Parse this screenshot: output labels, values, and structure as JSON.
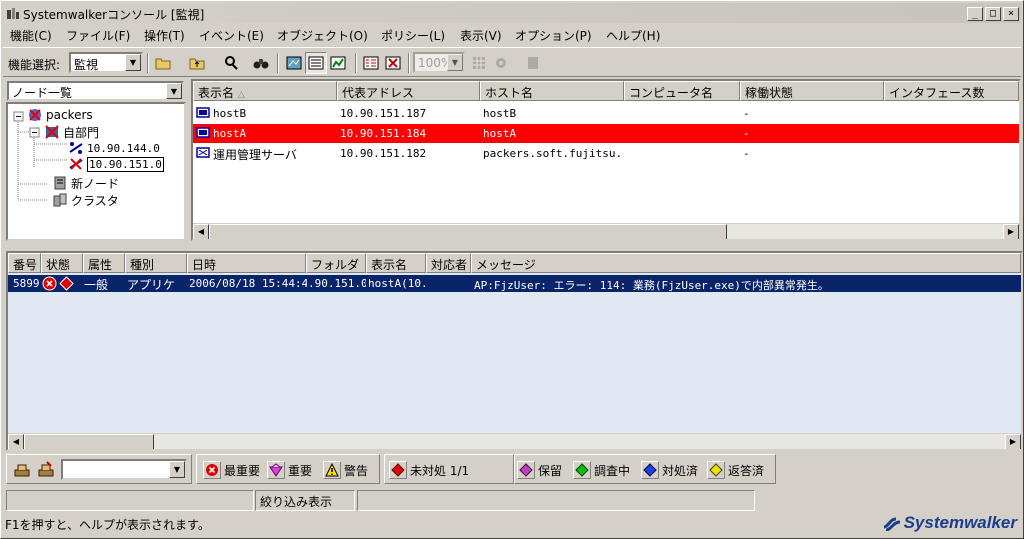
{
  "window": {
    "title": "Systemwalkerコンソール [監視]",
    "buttons": [
      "_",
      "□",
      "×"
    ]
  },
  "menu": [
    "機能(C)",
    "ファイル(F)",
    "操作(T)",
    "イベント(E)",
    "オブジェクト(O)",
    "ポリシー(L)",
    "表示(V)",
    "オプション(P)",
    "ヘルプ(H)"
  ],
  "toolbar": {
    "function_label": "機能選択:",
    "function_value": "監視",
    "zoom_value": "100%"
  },
  "tree": {
    "dropdown": "ノード一覧",
    "nodes": [
      {
        "label": "packers"
      },
      {
        "label": "自部門"
      },
      {
        "label": "10.90.144.0"
      },
      {
        "label": "10.90.151.0"
      },
      {
        "label": "新ノード"
      },
      {
        "label": "クラスタ"
      }
    ]
  },
  "node_list": {
    "columns": [
      "表示名",
      "代表アドレス",
      "ホスト名",
      "コンピュータ名",
      "稼働状態",
      "インタフェース数"
    ],
    "sort_indicator": "△",
    "rows": [
      {
        "name": "hostB",
        "address": "10.90.151.187",
        "host": "hostB",
        "computer": "",
        "status": "-"
      },
      {
        "name": "hostA",
        "address": "10.90.151.184",
        "host": "hostA",
        "computer": "",
        "status": "-",
        "selected": true
      },
      {
        "name": "運用管理サーバ",
        "address": "10.90.151.182",
        "host": "packers.soft.fujitsu.co",
        "computer": "",
        "status": "-"
      }
    ]
  },
  "messages": {
    "columns": [
      "番号",
      "状態",
      "属性",
      "種別",
      "日時",
      "フォルダ",
      "表示名",
      "対応者",
      "メッセージ"
    ],
    "rows": [
      {
        "number": "5899",
        "attribute": "一般",
        "type": "アプリケ",
        "datetime": "2006/08/18 15:44:45",
        "folder": ".90.151.0",
        "display": "hostA(10.",
        "responder": "",
        "message": "AP:FjzUser: エラー: 114: 業務(FjzUser.exe)で内部異常発生。"
      }
    ]
  },
  "legend": {
    "severity": [
      "最重要",
      "重要",
      "警告"
    ],
    "unhandled": "未対処 1/1",
    "states": [
      "保留",
      "調査中",
      "対処済",
      "返答済"
    ]
  },
  "status": {
    "filter": "絞り込み表示",
    "help": "F1を押すと、ヘルプが表示されます。",
    "brand": "Systemwalker"
  },
  "colors": {
    "selected_row": "#ff0000",
    "message_row": "#0a246a",
    "brand": "#1c3c8c"
  }
}
